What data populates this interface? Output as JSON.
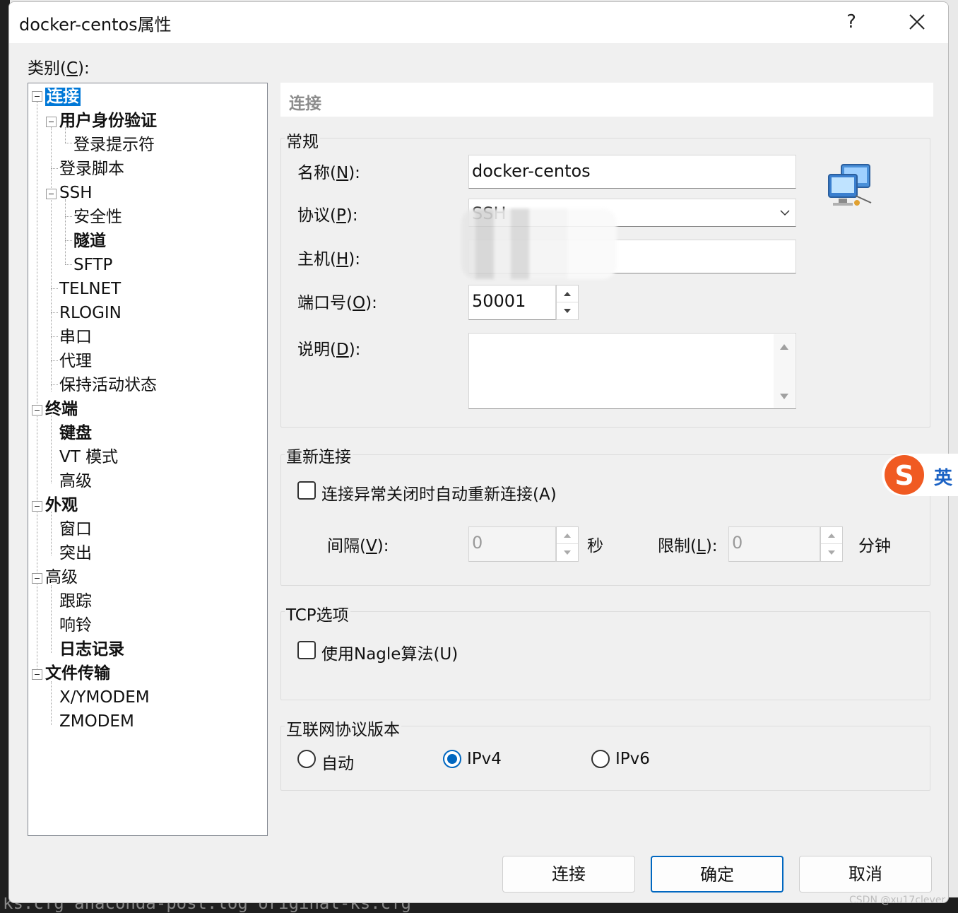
{
  "window": {
    "title": "docker-centos属性",
    "help": "?"
  },
  "category": {
    "label_prefix": "类别(",
    "label_key": "C",
    "label_suffix": "):"
  },
  "tree": [
    {
      "label": "连接"
    },
    {
      "label": "用户身份验证"
    },
    {
      "label": "登录提示符"
    },
    {
      "label": "登录脚本"
    },
    {
      "label": "SSH"
    },
    {
      "label": "安全性"
    },
    {
      "label": "隧道"
    },
    {
      "label": "SFTP"
    },
    {
      "label": "TELNET"
    },
    {
      "label": "RLOGIN"
    },
    {
      "label": "串口"
    },
    {
      "label": "代理"
    },
    {
      "label": "保持活动状态"
    },
    {
      "label": "终端"
    },
    {
      "label": "键盘"
    },
    {
      "label": "VT 模式"
    },
    {
      "label": "高级"
    },
    {
      "label": "外观"
    },
    {
      "label": "窗口"
    },
    {
      "label": "突出"
    },
    {
      "label": "高级"
    },
    {
      "label": "跟踪"
    },
    {
      "label": "响铃"
    },
    {
      "label": "日志记录"
    },
    {
      "label": "文件传输"
    },
    {
      "label": "X/YMODEM"
    },
    {
      "label": "ZMODEM"
    }
  ],
  "section_header": "连接",
  "general": {
    "title": "常规",
    "name_label": {
      "pre": "名称(",
      "key": "N",
      "post": "):"
    },
    "name_value": "docker-centos",
    "protocol_label": {
      "pre": "协议(",
      "key": "P",
      "post": "):"
    },
    "protocol_value": "SSH",
    "host_label": {
      "pre": "主机(",
      "key": "H",
      "post": "):"
    },
    "host_value": "",
    "port_label": {
      "pre": "端口号(",
      "key": "O",
      "post": "):"
    },
    "port_value": "50001",
    "desc_label": {
      "pre": "说明(",
      "key": "D",
      "post": "):"
    },
    "desc_value": ""
  },
  "reconnect": {
    "title": "重新连接",
    "auto_label": "连接异常关闭时自动重新连接(A)",
    "interval_label": {
      "pre": "间隔(",
      "key": "V",
      "post": "):"
    },
    "interval_value": "0",
    "interval_unit": "秒",
    "limit_label": {
      "pre": "限制(",
      "key": "L",
      "post": "):"
    },
    "limit_value": "0",
    "limit_unit": "分钟"
  },
  "tcp": {
    "title": "TCP选项",
    "nagle_label": "使用Nagle算法(U)"
  },
  "ip": {
    "title": "互联网协议版本",
    "options": [
      "自动",
      "IPv4",
      "IPv6"
    ],
    "selected": "IPv4"
  },
  "buttons": {
    "connect": "连接",
    "ok": "确定",
    "cancel": "取消"
  },
  "ime": {
    "label": "英"
  },
  "background": {
    "terminal_text": "ks.cfg  anaconda-post.log  original-ks.cfg"
  },
  "watermark": "CSDN @xu17clever"
}
